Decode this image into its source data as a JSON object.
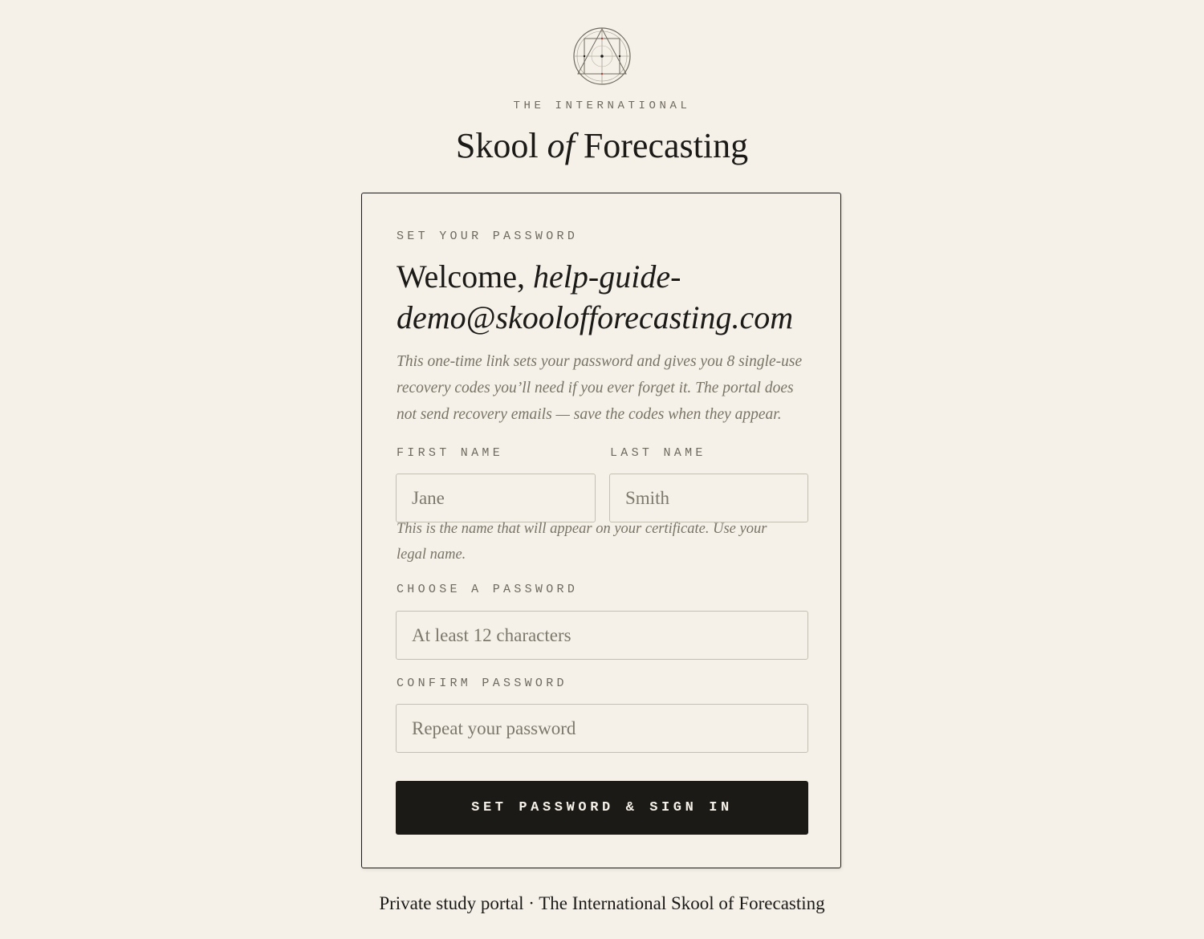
{
  "header": {
    "logo_icon": "geometric-seal-icon",
    "eyebrow": "THE INTERNATIONAL",
    "brand_part1": "Skool",
    "brand_of": "of",
    "brand_part2": "Forecasting"
  },
  "card": {
    "eyebrow": "SET YOUR PASSWORD",
    "welcome_prefix": "Welcome,",
    "email": "help-guide-demo@skoolofforecasting.com",
    "intro": "This one-time link sets your password and gives you 8 single-use recovery codes you’ll need if you ever forget it. The portal does not send recovery emails — save the codes when they appear.",
    "first_name": {
      "label": "FIRST NAME",
      "placeholder": "Jane",
      "value": ""
    },
    "last_name": {
      "label": "LAST NAME",
      "placeholder": "Smith",
      "value": ""
    },
    "name_hint": "This is the name that will appear on your certificate. Use your legal name.",
    "password": {
      "label": "CHOOSE A PASSWORD",
      "placeholder": "At least 12 characters",
      "value": ""
    },
    "confirm_password": {
      "label": "CONFIRM PASSWORD",
      "placeholder": "Repeat your password",
      "value": ""
    },
    "submit_label": "SET PASSWORD & SIGN IN"
  },
  "footer": {
    "text": "Private study portal · The International Skool of Forecasting"
  },
  "colors": {
    "background": "#f5f1e9",
    "ink": "#1b1a17",
    "muted": "#6f6a5f",
    "button": "#1c1a16"
  }
}
